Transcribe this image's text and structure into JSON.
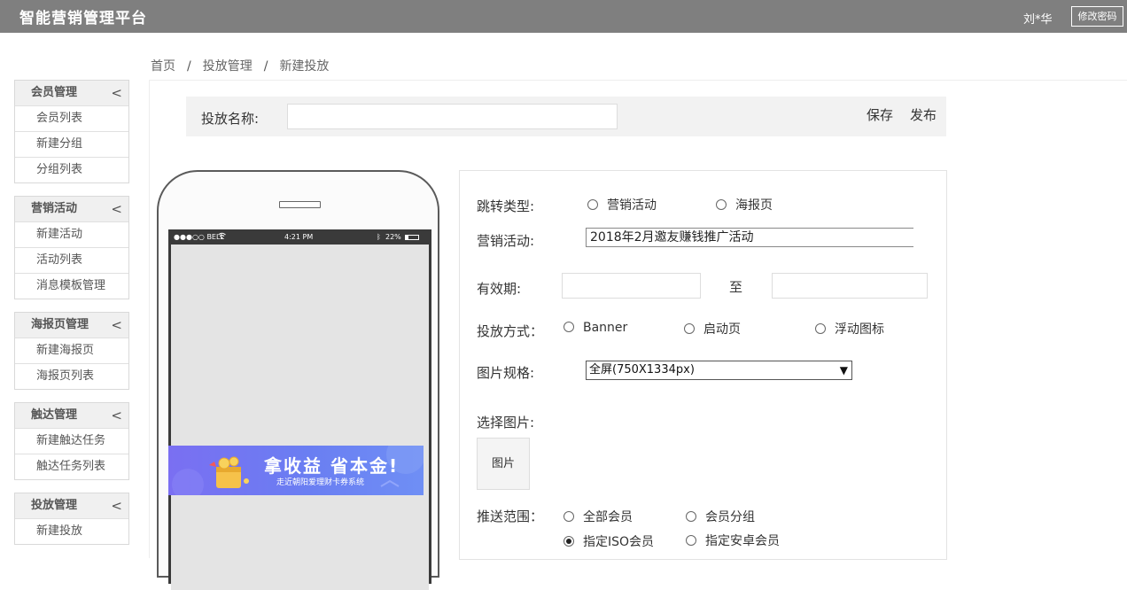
{
  "header": {
    "app_title": "智能营销管理平台",
    "user_name": "刘*华",
    "change_password": "修改密码"
  },
  "breadcrumb": {
    "items": [
      "首页",
      "投放管理",
      "新建投放"
    ],
    "separator": "/"
  },
  "sidebar": {
    "groups": [
      {
        "title": "会员管理",
        "items": [
          "会员列表",
          "新建分组",
          "分组列表"
        ]
      },
      {
        "title": "营销活动",
        "items": [
          "新建活动",
          "活动列表",
          "消息模板管理"
        ]
      },
      {
        "title": "海报页管理",
        "items": [
          "新建海报页",
          "海报页列表"
        ]
      },
      {
        "title": "触达管理",
        "items": [
          "新建触达任务",
          "触达任务列表"
        ]
      },
      {
        "title": "投放管理",
        "items": [
          "新建投放"
        ]
      }
    ],
    "collapse_glyph": "<"
  },
  "name_bar": {
    "label": "投放名称:",
    "value": "",
    "save": "保存",
    "publish": "发布"
  },
  "phone": {
    "status_left": "●●●○○ BELL",
    "time": "4:21 PM",
    "battery": "22%",
    "banner_title": "拿收益 省本金!",
    "banner_subtitle": "走近朝阳爱理财卡券系统"
  },
  "form": {
    "jump_type": {
      "label": "跳转类型:",
      "options": [
        "营销活动",
        "海报页"
      ],
      "selected": null
    },
    "activity": {
      "label": "营销活动:",
      "value": "2018年2月邀友赚钱推广活动"
    },
    "validity": {
      "label": "有效期:",
      "to": "至",
      "start": "",
      "end": ""
    },
    "delivery": {
      "label": "投放方式：",
      "options": [
        "Banner",
        "启动页",
        "浮动图标"
      ],
      "selected": null
    },
    "spec": {
      "label": "图片规格:",
      "value": "全屏(750X1334px)"
    },
    "image": {
      "label": "选择图片:",
      "placeholder": "图片"
    },
    "scope": {
      "label": "推送范围：",
      "options": [
        "全部会员",
        "会员分组",
        "指定ISO会员",
        "指定安卓会员"
      ],
      "selected": "指定ISO会员"
    }
  },
  "colors": {
    "topbar": "#7f7f7f",
    "banner": "#6f7af2",
    "accent_gold": "#f6c24a"
  }
}
